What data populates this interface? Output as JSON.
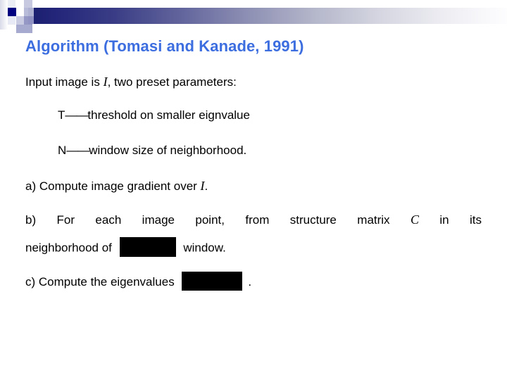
{
  "slide": {
    "title": "Algorithm (Tomasi and Kanade, 1991)",
    "title_color": "#3d6ee0",
    "background_color": "#ffffff",
    "text_color": "#000000"
  },
  "decor": {
    "bar_gradient_from": "#1b1f6e",
    "bar_gradient_to": "#fdfdfe",
    "square_dark": "#000080",
    "square_mid": "#8b8fc0",
    "square_light": "#c4c7de",
    "square_pale": "#dedfee"
  },
  "body": {
    "intro": {
      "before_var": "Input image is ",
      "var": "I",
      "after_var": ", two preset parameters:"
    },
    "param_t": {
      "symbol": "T",
      "dash": "——",
      "text": "threshold on smaller eignvalue"
    },
    "param_n": {
      "symbol": "N",
      "dash": "——",
      "text": "window size of neighborhood."
    },
    "step_a": {
      "marker": "a)",
      "before_var": " Compute image gradient over ",
      "var": "I",
      "after_var": "."
    },
    "step_b": {
      "marker": "b)",
      "line1_before_var": "For each image point, from structure matrix ",
      "line1_var": "C",
      "line1_after_var": " in its",
      "line2_before_box": "neighborhood of ",
      "line2_box": "missing-image-placeholder",
      "line2_after_box": " window."
    },
    "step_c": {
      "marker": "c)",
      "before_box": " Compute the eigenvalues ",
      "box": "missing-image-placeholder",
      "after_box": "."
    }
  }
}
